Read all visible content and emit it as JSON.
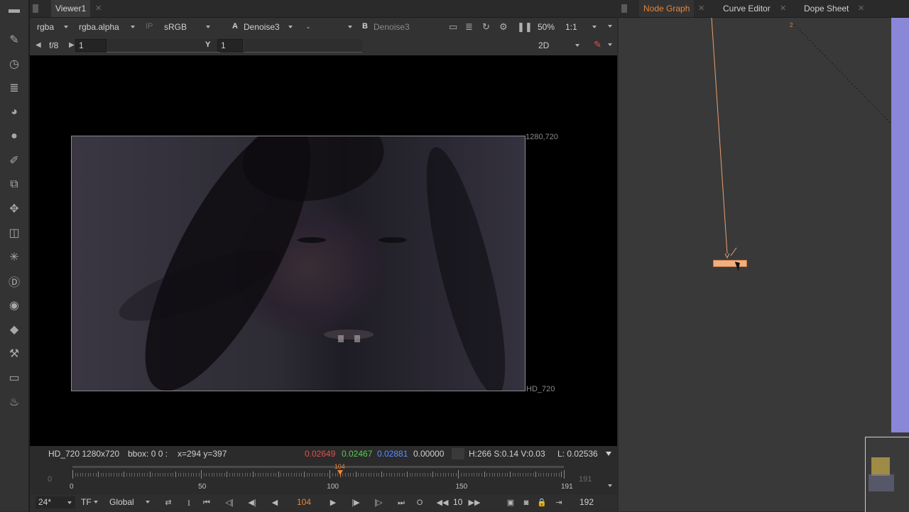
{
  "toolbar": {
    "tools": [
      {
        "icon": "grip-icon",
        "glyph": "▬"
      },
      {
        "icon": "paint-brush-icon",
        "glyph": "✎"
      },
      {
        "icon": "clock-icon",
        "glyph": "◷"
      },
      {
        "icon": "channel-bars-icon",
        "glyph": "≣"
      },
      {
        "icon": "color-wheel-icon",
        "glyph": "◕"
      },
      {
        "icon": "sphere-icon",
        "glyph": "●"
      },
      {
        "icon": "brush-tool-icon",
        "glyph": "✐"
      },
      {
        "icon": "layers-icon",
        "glyph": "⧉"
      },
      {
        "icon": "move-icon",
        "glyph": "✥"
      },
      {
        "icon": "cube-icon",
        "glyph": "◫"
      },
      {
        "icon": "particles-icon",
        "glyph": "✳"
      },
      {
        "icon": "d-icon",
        "glyph": "Ⓓ"
      },
      {
        "icon": "eye-icon",
        "glyph": "◉"
      },
      {
        "icon": "tags-icon",
        "glyph": "◆"
      },
      {
        "icon": "wrench-icon",
        "glyph": "⚒"
      },
      {
        "icon": "drawer-icon",
        "glyph": "▭"
      },
      {
        "icon": "fire-icon",
        "glyph": "♨"
      }
    ]
  },
  "viewer": {
    "tab_label": "Viewer1",
    "close_glyph": "✕",
    "controls": {
      "channels": "rgba",
      "alpha": "rgba.alpha",
      "ip": "IP",
      "colorspace": "sRGB",
      "a_label": "A",
      "a_input": "Denoise3",
      "a_op": "-",
      "b_label": "B",
      "b_input": "Denoise3",
      "zoom": "50%",
      "ratio": "1:1"
    },
    "row2": {
      "fstop": "f/8",
      "gain": "1",
      "y_label": "Y",
      "gamma": "1",
      "view_mode": "2D"
    },
    "image": {
      "top_right": "1280,720",
      "bottom_right": "HD_720"
    },
    "info": {
      "format": "HD_720 1280x720",
      "bbox": "bbox: 0 0 :",
      "coords": "x=294 y=397",
      "r": "0.02649",
      "g": "0.02467",
      "b": "0.02881",
      "a": "0.00000",
      "hsv": "H:266 S:0.14 V:0.03",
      "lum": "L: 0.02536"
    },
    "timeline": {
      "in_frame": "0",
      "out_frame": "191",
      "current_marker": "104",
      "labels": [
        "0",
        "50",
        "100",
        "150",
        "191"
      ],
      "current_frame": 104,
      "first_frame": 0,
      "last_frame": 191
    },
    "playback": {
      "fps": "24*",
      "tf": "TF",
      "scope": "Global",
      "in_btn": "I",
      "current": "104",
      "out_btn": "O",
      "step": "10",
      "end": "192"
    }
  },
  "nodegraph": {
    "tabs": [
      {
        "label": "Node Graph",
        "active": true
      },
      {
        "label": "Curve Editor",
        "active": false
      },
      {
        "label": "Dope Sheet",
        "active": false
      }
    ],
    "node_number": "2"
  },
  "colors": {
    "accent": "#e8853a",
    "red": "#e05050",
    "green": "#50d050",
    "blue": "#5a8cff",
    "backdrop": "#8a86d8"
  }
}
